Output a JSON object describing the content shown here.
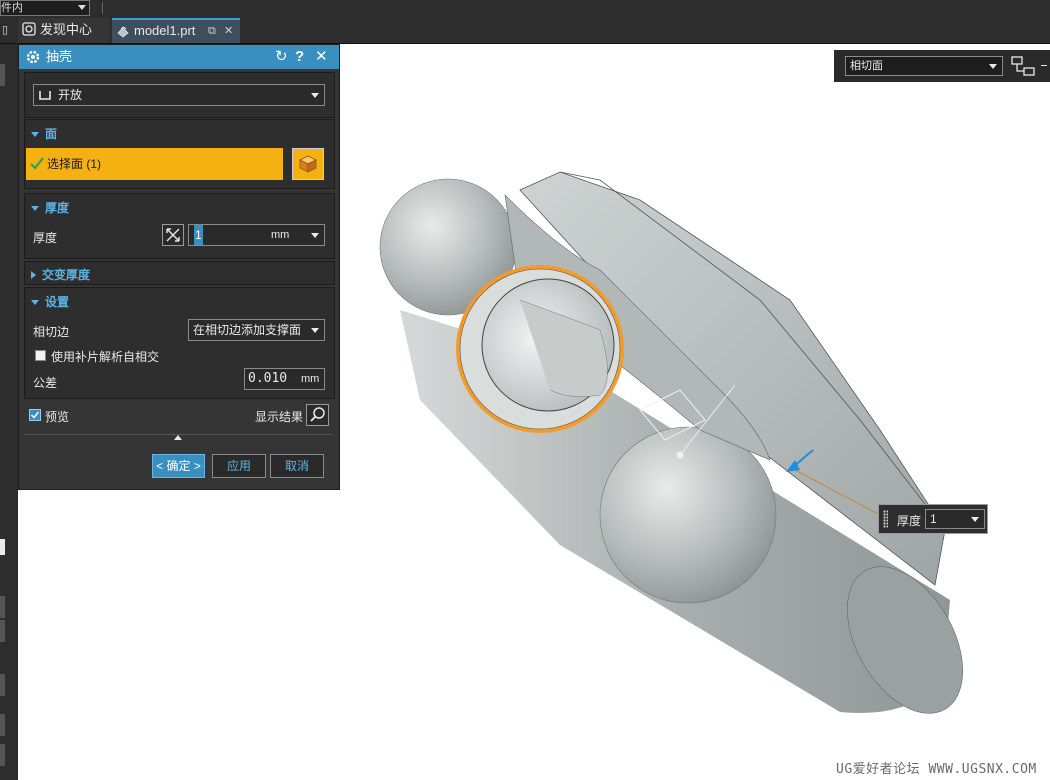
{
  "topbar": {
    "combo_value": "件内"
  },
  "tabs": [
    {
      "label": "发现中心"
    },
    {
      "label": "model1.prt"
    }
  ],
  "dialog": {
    "title": "抽壳",
    "type_select": "开放",
    "face_section": {
      "title": "面",
      "select_label": "选择面 (1)"
    },
    "thickness_section": {
      "title": "厚度",
      "label": "厚度",
      "value": "1",
      "unit": "mm"
    },
    "alternate_section": {
      "title": "交变厚度"
    },
    "settings_section": {
      "title": "设置",
      "tangent_label": "相切边",
      "tangent_value": "在相切边添加支撑面",
      "patch_checkbox_label": "使用补片解析自相交",
      "patch_checked": false,
      "tolerance_label": "公差",
      "tolerance_value": "0.010",
      "tolerance_unit": "mm"
    },
    "preview_label": "预览",
    "preview_checked": true,
    "show_result_label": "显示结果",
    "buttons": {
      "ok": "< 确定 >",
      "apply": "应用",
      "cancel": "取消"
    }
  },
  "view_toolbar": {
    "filter_value": "相切面"
  },
  "onscreen_input": {
    "label": "厚度",
    "value": "1"
  },
  "watermark": "UG爱好者论坛 WWW.UGSNX.COM",
  "colors": {
    "accent": "#3a8fc1",
    "selection": "#f5b012",
    "highlight_ring": "#f39a2c"
  }
}
